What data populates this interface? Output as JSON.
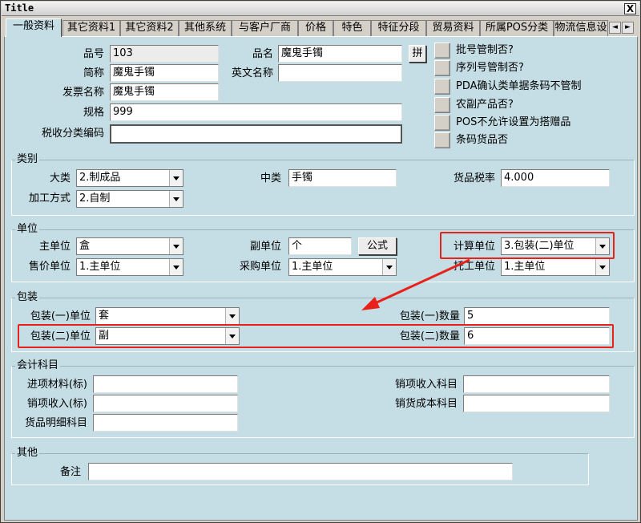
{
  "window": {
    "title": "Title",
    "close_label": "X"
  },
  "tabs": [
    "一般资料",
    "其它资料1",
    "其它资料2",
    "其他系统",
    "与客户厂商",
    "价格",
    "特色",
    "特征分段",
    "贸易资料",
    "所属POS分类",
    "物流信息设"
  ],
  "tab_scroll": {
    "left": "◄",
    "right": "►"
  },
  "basic": {
    "code_label": "品号",
    "code_value": "103",
    "name_label": "品名",
    "name_value": "魔鬼手镯",
    "pinyin_button": "拼",
    "short_label": "简称",
    "short_value": "魔鬼手镯",
    "english_label": "英文名称",
    "english_value": "",
    "invoice_label": "发票名称",
    "invoice_value": "魔鬼手镯",
    "spec_label": "规格",
    "spec_value": "999",
    "tax_code_label": "税收分类编码",
    "tax_code_value": ""
  },
  "checks": [
    "批号管制否?",
    "序列号管制否?",
    "PDA确认类单据条码不管制",
    "农副产品否?",
    "POS不允许设置为搭赠品",
    "条码货品否"
  ],
  "category": {
    "title": "类别",
    "big_label": "大类",
    "big_value": "2.制成品",
    "mid_label": "中类",
    "mid_value": "手镯",
    "tax_rate_label": "货品税率",
    "tax_rate_value": "4.000",
    "process_label": "加工方式",
    "process_value": "2.自制"
  },
  "unit": {
    "title": "单位",
    "main_label": "主单位",
    "main_value": "盒",
    "sub_label": "副单位",
    "sub_value": "个",
    "formula_button": "公式",
    "calc_label": "计算单位",
    "calc_value": "3.包装(二)单位",
    "sale_label": "售价单位",
    "sale_value": "1.主单位",
    "purchase_label": "采购单位",
    "purchase_value": "1.主单位",
    "outsource_label": "托工单位",
    "outsource_value": "1.主单位"
  },
  "package": {
    "title": "包装",
    "pkg1_unit_label": "包装(一)单位",
    "pkg1_unit_value": "套",
    "pkg1_qty_label": "包装(一)数量",
    "pkg1_qty_value": "5",
    "pkg2_unit_label": "包装(二)单位",
    "pkg2_unit_value": "副",
    "pkg2_qty_label": "包装(二)数量",
    "pkg2_qty_value": "6"
  },
  "accounting": {
    "title": "会计科目",
    "purchase_material_label": "进项材料(标)",
    "purchase_material_value": "",
    "sales_income_label": "销项收入科目",
    "sales_income_value": "",
    "sales_income_std_label": "销项收入(标)",
    "sales_income_std_value": "",
    "sales_cost_label": "销货成本科目",
    "sales_cost_value": "",
    "goods_detail_label": "货品明细科目",
    "goods_detail_value": ""
  },
  "other": {
    "title": "其他",
    "remark_label": "备注",
    "remark_value": ""
  },
  "colors": {
    "panel": "#c5dde4",
    "highlight": "#e8221a"
  }
}
